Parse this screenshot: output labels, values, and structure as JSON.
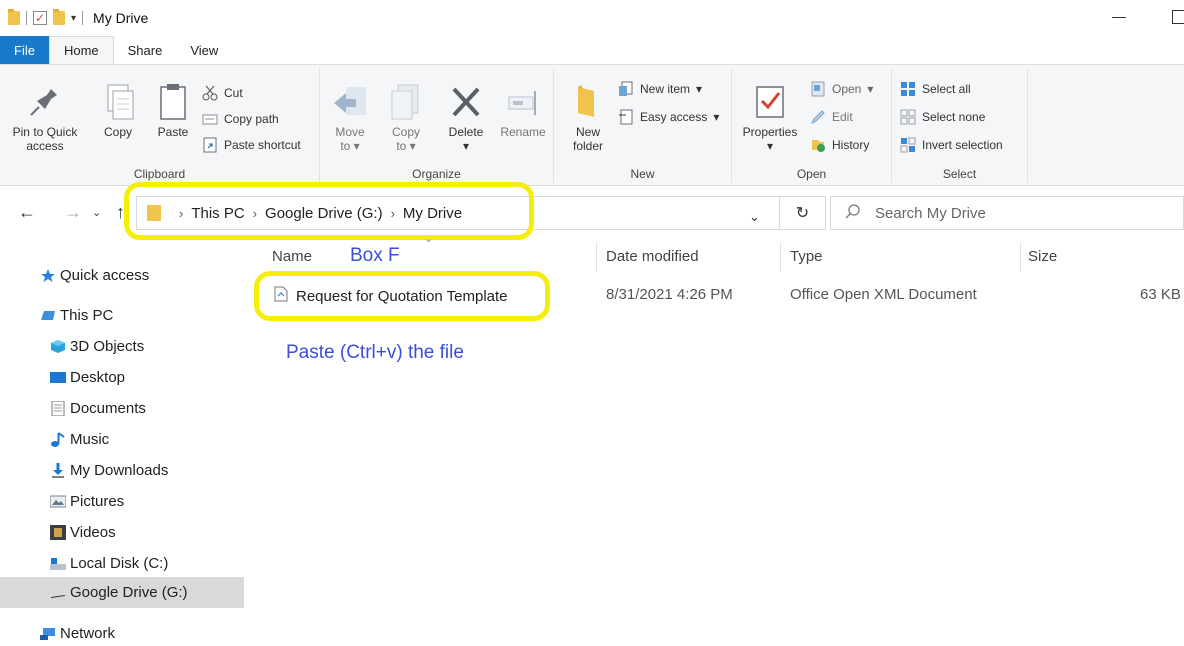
{
  "window": {
    "title": "My Drive"
  },
  "tabs": [
    "File",
    "Home",
    "Share",
    "View"
  ],
  "ribbon": {
    "clipboard": {
      "label": "Clipboard",
      "pin": "Pin to Quick",
      "pin2": "access",
      "copy": "Copy",
      "paste": "Paste",
      "cut": "Cut",
      "copy_path": "Copy path",
      "paste_shortcut": "Paste shortcut"
    },
    "organize": {
      "label": "Organize",
      "move": "Move",
      "move2": "to",
      "copy": "Copy",
      "copy2": "to",
      "delete": "Delete",
      "rename": "Rename"
    },
    "new": {
      "label": "New",
      "new_folder": "New",
      "new_folder2": "folder",
      "new_item": "New item",
      "easy_access": "Easy access"
    },
    "open": {
      "label": "Open",
      "properties": "Properties",
      "open": "Open",
      "edit": "Edit",
      "history": "History"
    },
    "select": {
      "label": "Select",
      "select_all": "Select all",
      "select_none": "Select none",
      "invert": "Invert selection"
    }
  },
  "address": {
    "crumbs": [
      "This PC",
      "Google Drive (G:)",
      "My Drive"
    ],
    "search_placeholder": "Search My Drive"
  },
  "navpane": [
    "Quick access",
    "This PC",
    "3D Objects",
    "Desktop",
    "Documents",
    "Music",
    "My Downloads",
    "Pictures",
    "Videos",
    "Local Disk (C:)",
    "Google Drive (G:)",
    "Network"
  ],
  "columns": {
    "name": "Name",
    "date": "Date modified",
    "type": "Type",
    "size": "Size"
  },
  "files": [
    {
      "name": "Request for Quotation Template",
      "date": "8/31/2021 4:26 PM",
      "type": "Office Open XML Document",
      "size": "63 KB"
    }
  ],
  "annotations": {
    "box": "Box F",
    "instruction": "Paste (Ctrl+v) the file"
  },
  "colors": {
    "file_tab": "#1979ca",
    "highlight": "#f5ee0a",
    "annotation": "#3a4fd6"
  }
}
